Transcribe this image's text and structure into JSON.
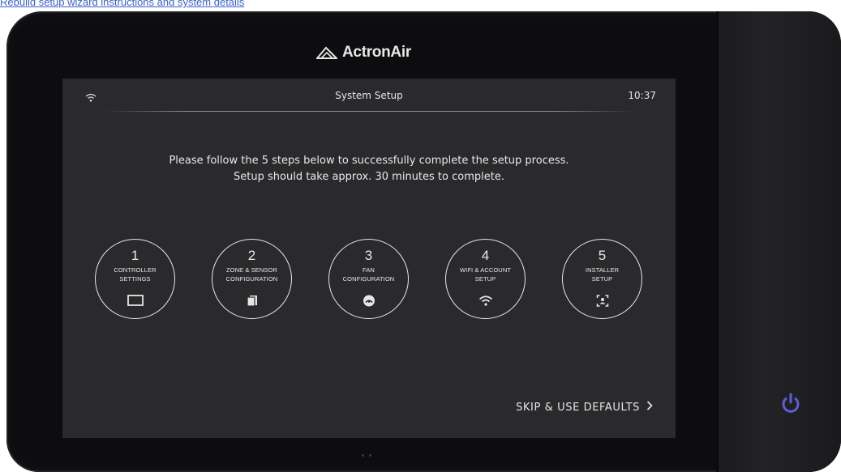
{
  "page": {
    "top_link": "Rebuild setup wizard instructions and system details"
  },
  "device": {
    "brand": "ActronAir"
  },
  "screen": {
    "title": "System Setup",
    "time": "10:37",
    "instructions_line1": "Please follow the 5 steps below to successfully complete the setup process.",
    "instructions_line2": "Setup should take approx. 30 minutes to complete.",
    "skip_label": "SKIP & USE DEFAULTS",
    "steps": [
      {
        "number": "1",
        "line1": "CONTROLLER",
        "line2": "SETTINGS",
        "icon": "controller-screen-icon"
      },
      {
        "number": "2",
        "line1": "ZONE & SENSOR",
        "line2": "CONFIGURATION",
        "icon": "sensor-icon"
      },
      {
        "number": "3",
        "line1": "FAN",
        "line2": "CONFIGURATION",
        "icon": "fan-icon"
      },
      {
        "number": "4",
        "line1": "WIFI & ACCOUNT",
        "line2": "SETUP",
        "icon": "wifi-icon"
      },
      {
        "number": "5",
        "line1": "INSTALLER",
        "line2": "SETUP",
        "icon": "installer-icon"
      }
    ]
  },
  "colors": {
    "screen_bg": "#2a2a2c",
    "bezel": "#0d0d0f",
    "text": "#e8e8e8",
    "power_accent": "#5b5fd6"
  }
}
